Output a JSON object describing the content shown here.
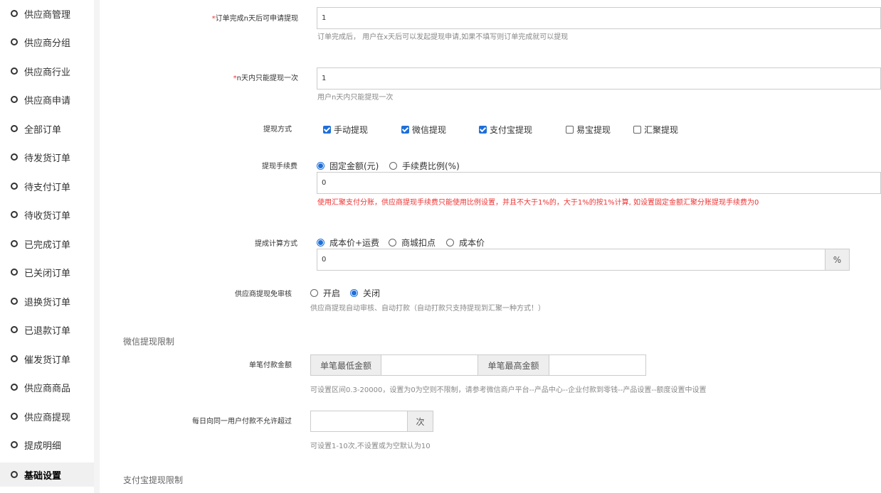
{
  "sidebar": {
    "items": [
      {
        "label": "供应商管理",
        "active": false
      },
      {
        "label": "供应商分组",
        "active": false
      },
      {
        "label": "供应商行业",
        "active": false
      },
      {
        "label": "供应商申请",
        "active": false
      },
      {
        "label": "全部订单",
        "active": false
      },
      {
        "label": "待发货订单",
        "active": false
      },
      {
        "label": "待支付订单",
        "active": false
      },
      {
        "label": "待收货订单",
        "active": false
      },
      {
        "label": "已完成订单",
        "active": false
      },
      {
        "label": "已关闭订单",
        "active": false
      },
      {
        "label": "退换货订单",
        "active": false
      },
      {
        "label": "已退款订单",
        "active": false
      },
      {
        "label": "催发货订单",
        "active": false
      },
      {
        "label": "供应商商品",
        "active": false
      },
      {
        "label": "供应商提现",
        "active": false
      },
      {
        "label": "提成明细",
        "active": false
      },
      {
        "label": "基础设置",
        "active": true
      }
    ]
  },
  "form": {
    "apply_days": {
      "required_mark": "*",
      "label": "订单完成n天后可申请提现",
      "value": "1",
      "help": "订单完成后， 用户在x天后可以发起提现申请,如果不填写则订单完成就可以提现"
    },
    "once_days": {
      "required_mark": "*",
      "label": "n天内只能提现一次",
      "value": "1",
      "help": "用户n天内只能提现一次"
    },
    "method": {
      "label": "提现方式",
      "options": [
        {
          "label": "手动提现",
          "checked": true
        },
        {
          "label": "微信提现",
          "checked": true
        },
        {
          "label": "支付宝提现",
          "checked": true
        },
        {
          "label": "易宝提现",
          "checked": false
        },
        {
          "label": "汇聚提现",
          "checked": false
        }
      ]
    },
    "fee": {
      "label": "提现手续费",
      "options": [
        {
          "label": "固定金额(元)",
          "selected": true
        },
        {
          "label": "手续费比例(%)",
          "selected": false
        }
      ],
      "value": "0",
      "warning": "使用汇聚支付分账，供应商提现手续费只能使用比例设置，并且不大于1%的，大于1%的按1%计算, 如设置固定金额汇聚分账提现手续费为0"
    },
    "calc": {
      "label": "提成计算方式",
      "options": [
        {
          "label": "成本价+运费",
          "selected": true
        },
        {
          "label": "商城扣点",
          "selected": false
        },
        {
          "label": "成本价",
          "selected": false
        }
      ],
      "value": "0",
      "suffix": "%"
    },
    "audit": {
      "label": "供应商提现免审核",
      "options": [
        {
          "label": "开启",
          "selected": false
        },
        {
          "label": "关闭",
          "selected": true
        }
      ],
      "help": "供应商提现自动审核、自动打款（自动打款只支持提现到汇聚一种方式！）"
    },
    "wechat_section": "微信提现限制",
    "single_amount": {
      "label": "单笔付款金额",
      "min_addon": "单笔最低金额",
      "max_addon": "单笔最高金额",
      "min_value": "",
      "max_value": "",
      "help": "可设置区间0.3-20000，设置为0为空则不限制，请参考微信商户平台--产品中心--企业付款到零钱--产品设置--额度设置中设置"
    },
    "daily_limit": {
      "label": "每日向同一用户付款不允许超过",
      "value": "",
      "suffix": "次",
      "help": "可设置1-10次,不设置或为空默认为10"
    },
    "alipay_section": "支付宝提现限制"
  },
  "colors": {
    "accent": "#1e6fd9",
    "warning": "#e33333"
  }
}
